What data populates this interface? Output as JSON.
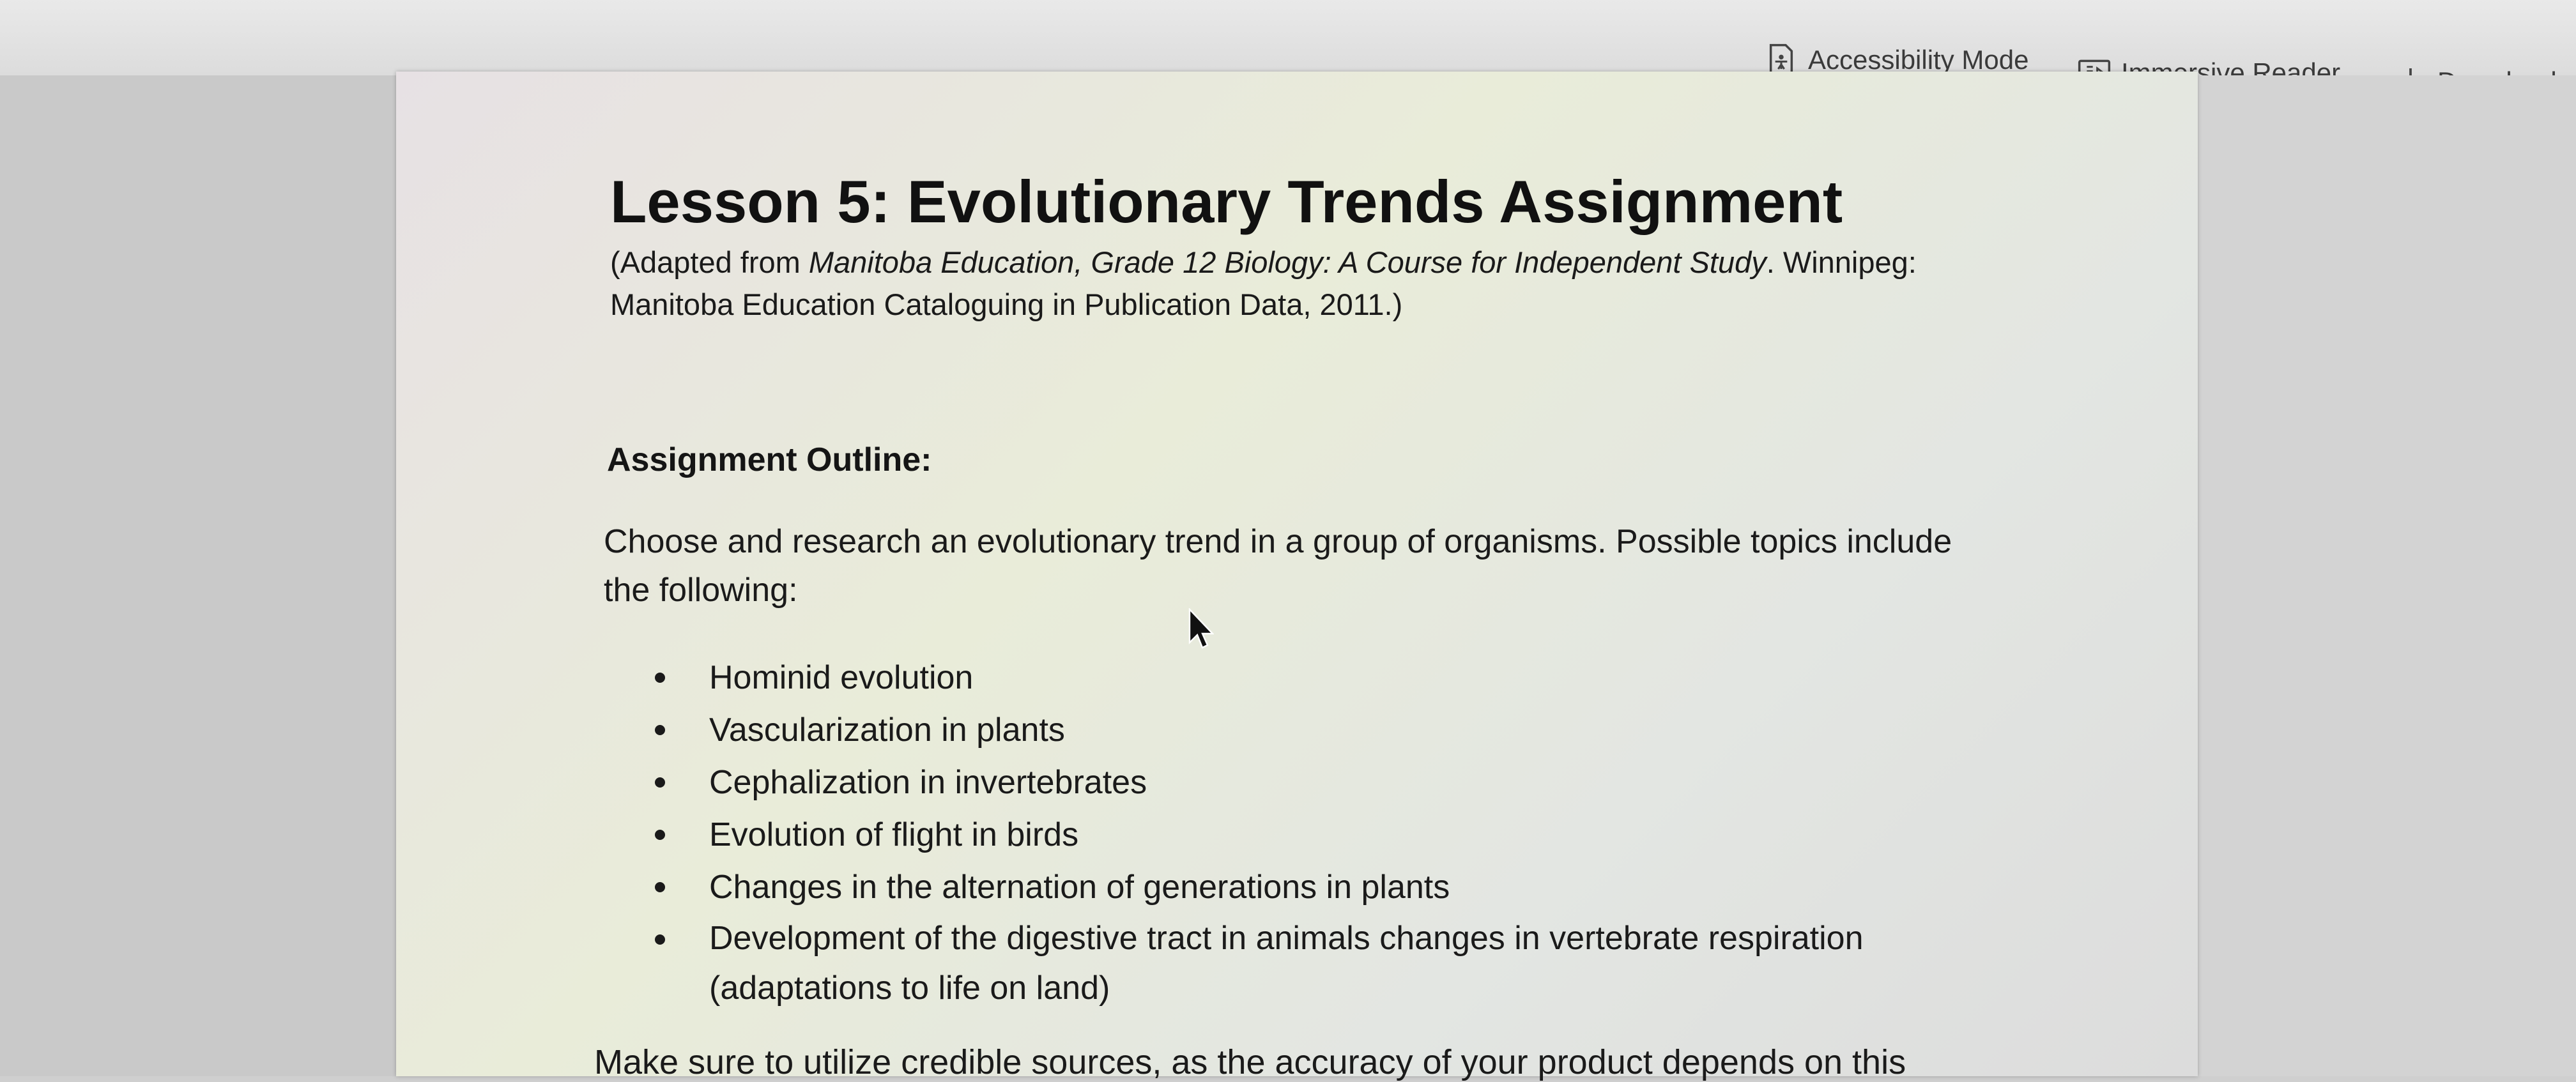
{
  "toolbar": {
    "accessibility_mode": "Accessibility Mode",
    "immersive_reader": "Immersive Reader",
    "download": "Download"
  },
  "icons": {
    "accessibility": "document-accessibility-icon",
    "immersive": "immersive-reader-icon",
    "download": "download-arrow-icon",
    "cursor": "mouse-pointer-icon"
  },
  "document": {
    "title": "Lesson 5: Evolutionary Trends Assignment",
    "adapted_prefix": "(Adapted from ",
    "adapted_source": "Manitoba Education, Grade 12 Biology: A Course for Independent Study",
    "adapted_suffix": ". Winnipeg: Manitoba Education Cataloguing in Publication Data, 2011.)",
    "outline_heading": "Assignment Outline:",
    "intro": "Choose and research an evolutionary trend in a group of organisms. Possible topics include the following:",
    "topics": [
      "Hominid evolution",
      "Vascularization in plants",
      "Cephalization in invertebrates",
      "Evolution of flight in birds",
      "Changes in the alternation of generations in plants",
      "Development of the digestive tract in animals changes in vertebrate respiration (adaptations to life on land)"
    ],
    "footer_partial": "Make sure to utilize credible sources, as the accuracy of your product depends on this"
  }
}
